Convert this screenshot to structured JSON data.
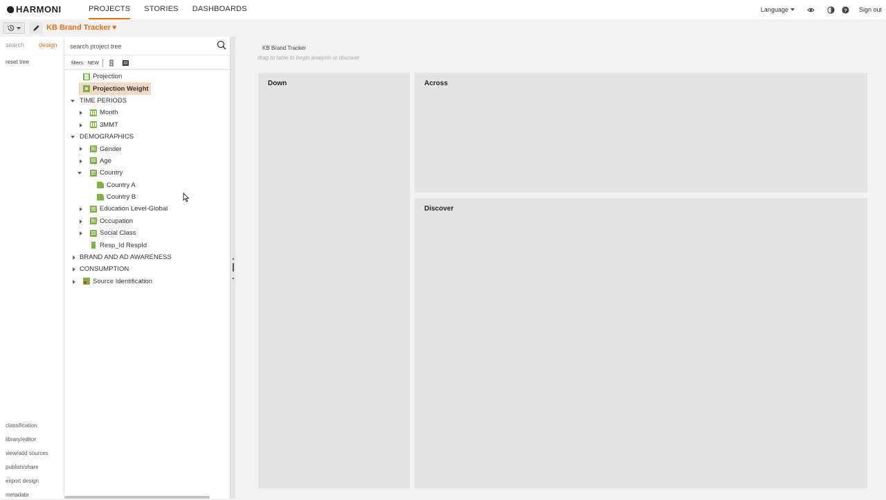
{
  "app": {
    "brand": "HARMONI"
  },
  "nav": {
    "tabs": [
      {
        "label": "PROJECTS",
        "active": true
      },
      {
        "label": "STORIES",
        "active": false
      },
      {
        "label": "DASHBOARDS",
        "active": false
      }
    ],
    "language_label": "Language",
    "sign_out_label": "Sign out"
  },
  "project": {
    "title": "KB Brand Tracker"
  },
  "rail": {
    "tabs": [
      {
        "label": "search",
        "active": false
      },
      {
        "label": "design",
        "active": true
      }
    ],
    "reset_tree": "reset tree",
    "links": [
      "classification",
      "library/editor",
      "view/add sources",
      "publish/share",
      "export design",
      "metadata"
    ]
  },
  "tree_panel": {
    "search_placeholder": "search project tree",
    "filters_label": "filters:",
    "filter_new": "NEW",
    "nodes": [
      {
        "label": "Projection"
      },
      {
        "label": "Projection Weight"
      },
      {
        "label": "TIME PERIODS"
      },
      {
        "label": "Month"
      },
      {
        "label": "3MMT"
      },
      {
        "label": "DEMOGRAPHICS"
      },
      {
        "label": "Gender"
      },
      {
        "label": "Age"
      },
      {
        "label": "Country"
      },
      {
        "label": "Country A"
      },
      {
        "label": "Country B"
      },
      {
        "label": "Education Level-Global"
      },
      {
        "label": "Occupation"
      },
      {
        "label": "Social Class"
      },
      {
        "label": "Resp_Id RespId"
      },
      {
        "label": "BRAND AND AD AWARENESS"
      },
      {
        "label": "CONSUMPTION"
      },
      {
        "label": "Source Identification"
      }
    ]
  },
  "main": {
    "breadcrumb": "KB Brand Tracker",
    "hint": "drag to table to begin analysis or discover",
    "zones": {
      "down": "Down",
      "across": "Across",
      "discover": "Discover"
    }
  },
  "colors": {
    "accent": "#ef6c1a",
    "node_green": "#7cb342",
    "selection": "#f1d9c6"
  }
}
